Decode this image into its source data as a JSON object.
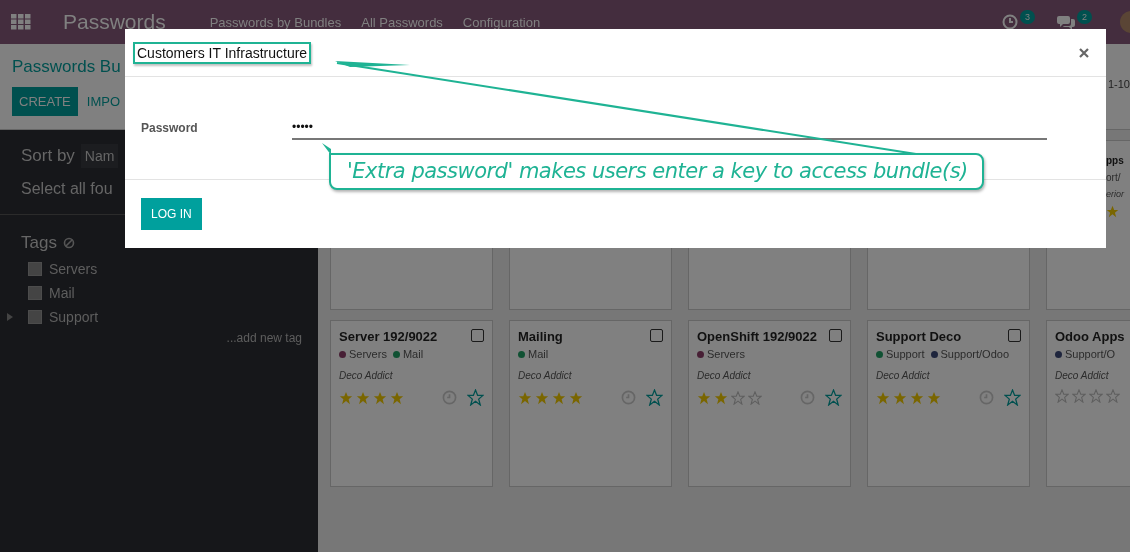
{
  "navbar": {
    "app_title": "Passwords",
    "menu": [
      {
        "label": "Passwords by Bundles"
      },
      {
        "label": "All Passwords"
      },
      {
        "label": "Configuration"
      }
    ],
    "activity_count": "3",
    "message_count": "2"
  },
  "control_panel": {
    "breadcrumb": "Passwords Bu",
    "buttons": [
      {
        "label": "CREATE",
        "kind": "primary"
      },
      {
        "label": "IMPO",
        "kind": "link"
      }
    ],
    "pager": "1-10"
  },
  "sidebar": {
    "sort_label": "Sort by",
    "sort_value": "Nam",
    "select_all": "Select all fou",
    "tags_title": "Tags",
    "tags": [
      {
        "label": "Servers",
        "checked": false
      },
      {
        "label": "Mail",
        "checked": false
      },
      {
        "label": "Support",
        "checked": false,
        "expanded": false
      }
    ],
    "add_tag": "...add new tag"
  },
  "partial_card": {
    "name": "pps",
    "tag": "ort/",
    "partner": "erior"
  },
  "cards": [
    {
      "name": "Server 192/9022",
      "checked": false,
      "tags": [
        {
          "label": "Servers",
          "color": "#471f35"
        },
        {
          "label": "Mail",
          "color": "#105133"
        }
      ],
      "partner": "Deco Addict",
      "stars": 4,
      "favorite": false
    },
    {
      "name": "Mailing",
      "checked": false,
      "tags": [
        {
          "label": "Mail",
          "color": "#105133"
        }
      ],
      "partner": "Deco Addict",
      "stars": 4,
      "favorite": false
    },
    {
      "name": "OpenShift 192/9022",
      "checked": false,
      "tags": [
        {
          "label": "Servers",
          "color": "#471f35"
        }
      ],
      "partner": "Deco Addict",
      "stars": 2,
      "favorite": false
    },
    {
      "name": "Support Deco",
      "checked": false,
      "tags": [
        {
          "label": "Support",
          "color": "#105133"
        },
        {
          "label": "Support/Odoo",
          "color": "#1e253d"
        }
      ],
      "partner": "Deco Addict",
      "stars": 4,
      "favorite": false
    },
    {
      "name": "Odoo Apps",
      "tags": [
        {
          "label": "Support/O",
          "color": "#1e253d"
        }
      ],
      "partner": "Deco Addict",
      "stars": 0
    }
  ],
  "dialog": {
    "title": "Customers IT Infrastructure",
    "field_label": "Password",
    "field_value": "•••••",
    "button": "LOG IN"
  },
  "annotation": {
    "text": "'Extra password' makes users enter a key to access bundle(s)"
  }
}
